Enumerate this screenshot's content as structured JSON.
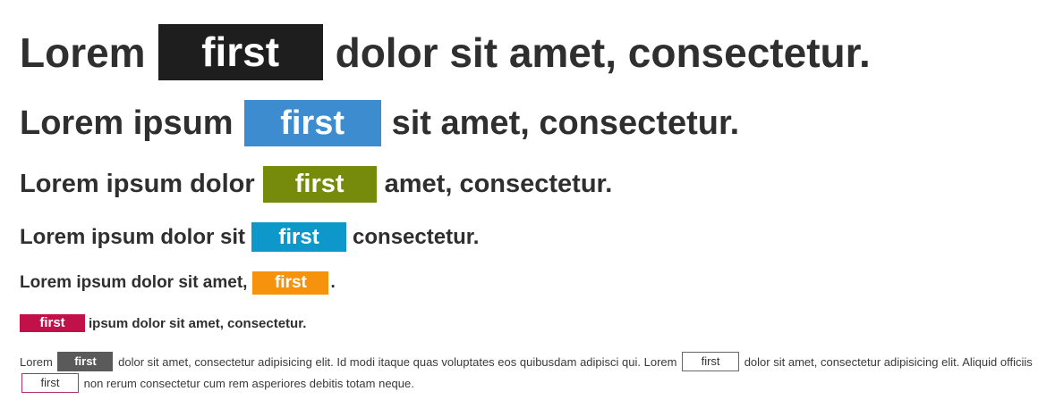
{
  "badge_text": "first",
  "rows": [
    {
      "before": "Lorem",
      "after": "dolor sit amet, consectetur.",
      "badge_color": "#1e1e1e"
    },
    {
      "before": "Lorem ipsum",
      "after": "sit amet, consectetur.",
      "badge_color": "#3c8ccf"
    },
    {
      "before": "Lorem ipsum dolor",
      "after": "amet, consectetur.",
      "badge_color": "#768b0b"
    },
    {
      "before": "Lorem ipsum dolor sit",
      "after": "consectetur.",
      "badge_color": "#0e97cb"
    },
    {
      "before": "Lorem ipsum dolor sit amet,",
      "after": ".",
      "badge_color": "#f7920c"
    },
    {
      "before": "",
      "after": "ipsum dolor sit amet, consectetur.",
      "badge_color": "#c2104a"
    }
  ],
  "paragraph": {
    "seg1": "Lorem",
    "seg2": "dolor sit amet, consectetur adipisicing elit. Id modi itaque quas voluptates eos quibusdam adipisci qui. Lorem",
    "seg3": "dolor sit amet, consectetur adipisicing elit. Aliquid officiis",
    "seg4": "non rerum consectetur cum rem asperiores debitis totam neque."
  }
}
